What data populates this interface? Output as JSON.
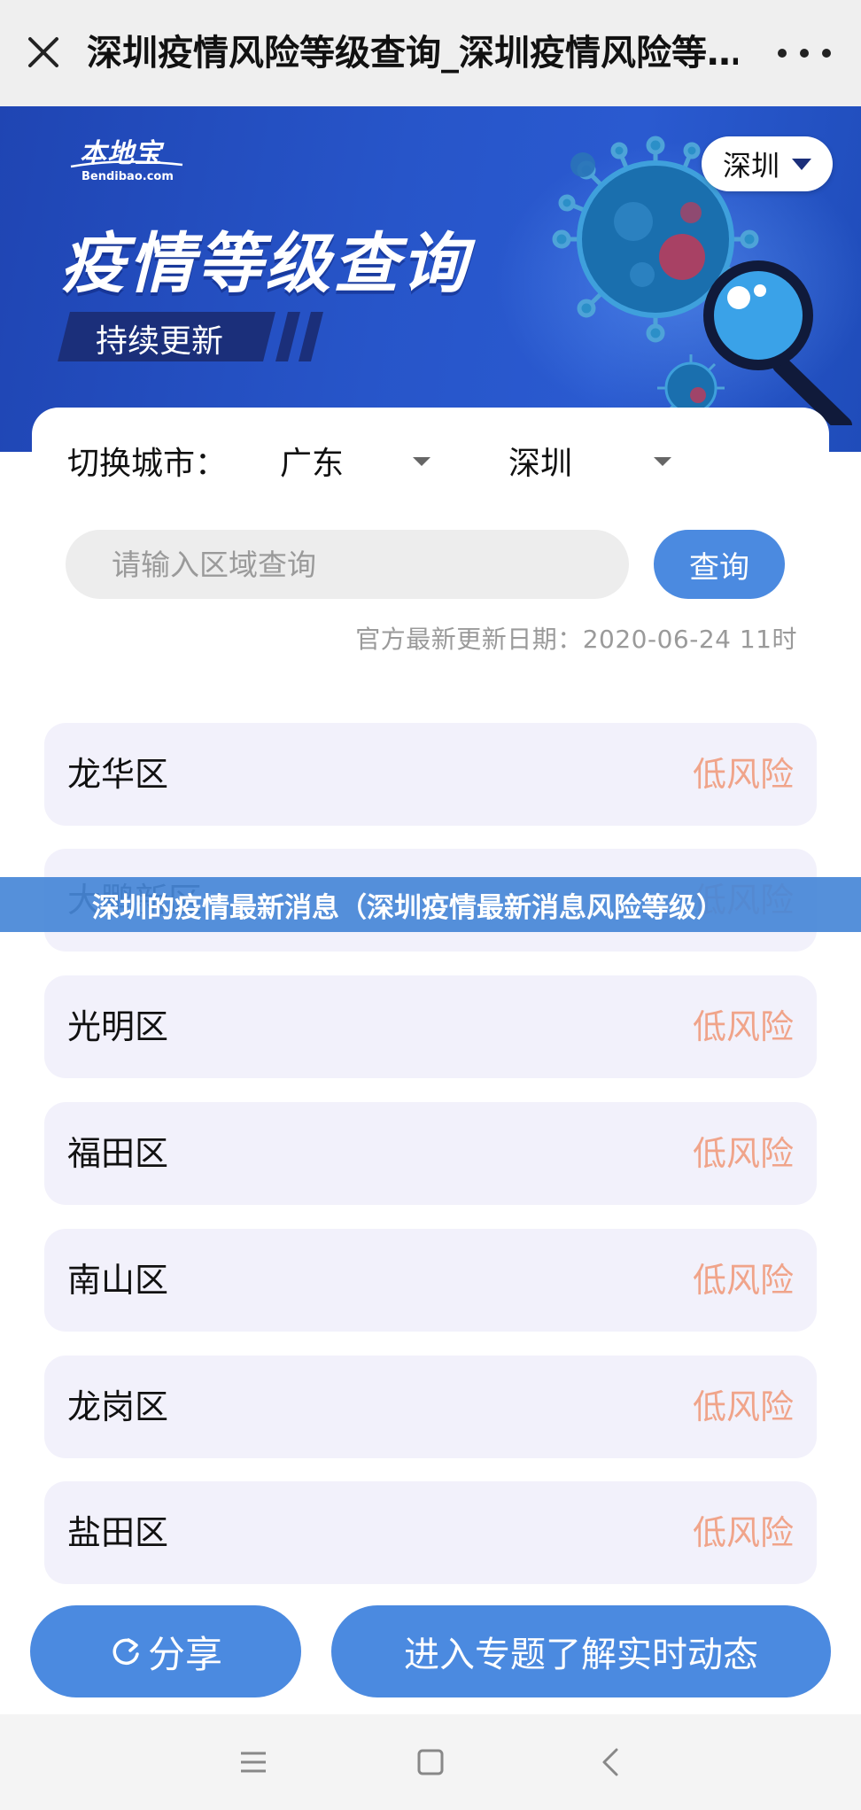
{
  "browser": {
    "title": "深圳疫情风险等级查询_深圳疫情风险等…"
  },
  "banner": {
    "logo_name": "本地宝",
    "logo_sub": "Bendibao.com",
    "headline": "疫情等级查询",
    "tagline": "持续更新",
    "city_pill": "深圳"
  },
  "filter": {
    "label": "切换城市：",
    "province": "广东",
    "city": "深圳"
  },
  "search": {
    "placeholder": "请输入区域查询",
    "value": "",
    "button": "查询"
  },
  "update_text": "官方最新更新日期：2020-06-24 11时",
  "districts": [
    {
      "name": "龙华区",
      "risk": "低风险"
    },
    {
      "name": "大鹏新区",
      "risk": "低风险"
    },
    {
      "name": "光明区",
      "risk": "低风险"
    },
    {
      "name": "福田区",
      "risk": "低风险"
    },
    {
      "name": "南山区",
      "risk": "低风险"
    },
    {
      "name": "龙岗区",
      "risk": "低风险"
    },
    {
      "name": "盐田区",
      "risk": "低风险"
    }
  ],
  "overlay_caption": "深圳的疫情最新消息（深圳疫情最新消息风险等级）",
  "actions": {
    "share": "分享",
    "enter": "进入专题了解实时动态"
  },
  "icons": {
    "close": "close-icon",
    "more": "more-icon",
    "dropdown": "triangle-down-icon",
    "share": "refresh-share-icon",
    "nav_menu": "menu-icon",
    "nav_home": "square-home-icon",
    "nav_back": "back-chevron-icon"
  },
  "colors": {
    "primary": "#4b8ae0",
    "risk_low": "#f0a48a",
    "row_bg": "#f2f1fb",
    "banner": "#2755c9"
  }
}
